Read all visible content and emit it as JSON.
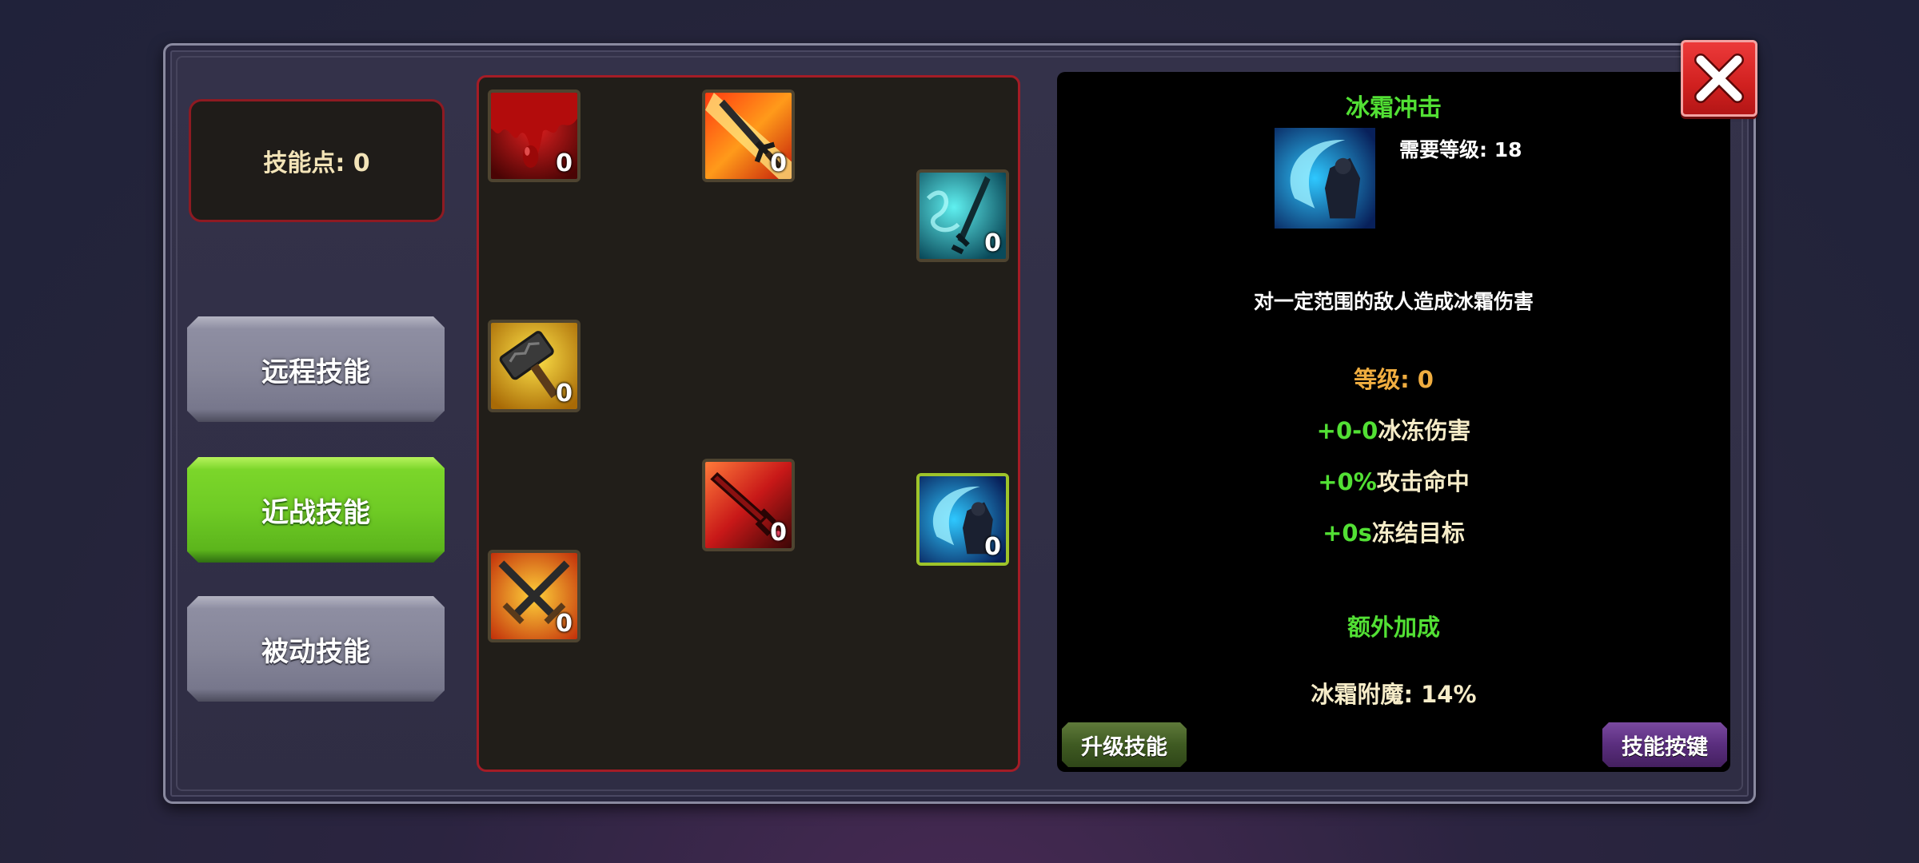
{
  "skill_points_label": "技能点: 0",
  "tabs": [
    {
      "label": "远程技能",
      "active": false
    },
    {
      "label": "近战技能",
      "active": true
    },
    {
      "label": "被动技能",
      "active": false
    }
  ],
  "skills": [
    {
      "icon": "blood-drip-icon",
      "level": "0"
    },
    {
      "icon": "flaming-sword-icon",
      "level": "0"
    },
    {
      "icon": "ice-sword-icon",
      "level": "0"
    },
    {
      "icon": "golden-hammer-icon",
      "level": "0"
    },
    {
      "icon": "blood-sword-icon",
      "level": "0"
    },
    {
      "icon": "frost-strike-icon",
      "level": "0",
      "selected": true
    },
    {
      "icon": "crossed-swords-icon",
      "level": "0"
    }
  ],
  "detail": {
    "title": "冰霜冲击",
    "icon": "frost-strike-icon",
    "required_level": "需要等级: 18",
    "description": "对一定范围的敌人造成冰霜伤害",
    "level_label": "等级: 0",
    "stats": [
      {
        "value": "+0-0",
        "label": "冰冻伤害"
      },
      {
        "value": "+0%",
        "label": "攻击命中"
      },
      {
        "value": "+0s",
        "label": "冻结目标"
      }
    ],
    "bonus_title": "额外加成",
    "bonus_text": "冰霜附魔: 14%",
    "upgrade_button": "升级技能",
    "keybind_button": "技能按键"
  },
  "colors": {
    "accent_green": "#52e034",
    "level_orange": "#f0ad40",
    "tree_border_red": "#a41c26",
    "active_tab_green": "#6fcb25",
    "close_red": "#d0201f"
  }
}
